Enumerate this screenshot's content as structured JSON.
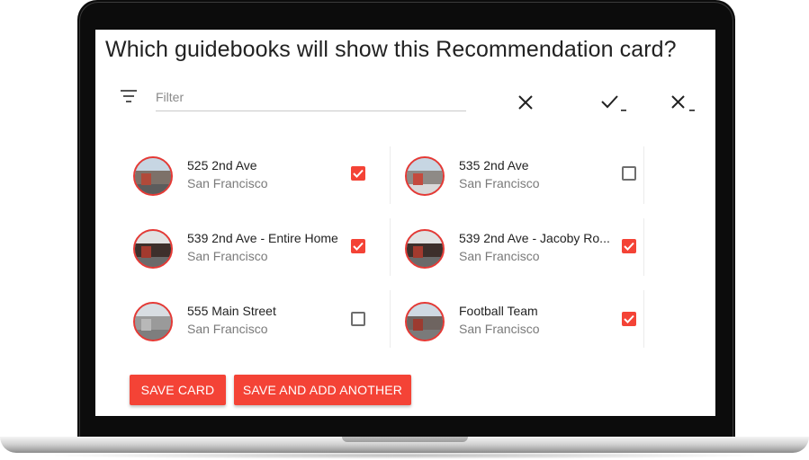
{
  "dialog": {
    "title": "Which guidebooks will show this Recommendation card?"
  },
  "filter": {
    "placeholder": "Filter",
    "value": ""
  },
  "toolbar": {
    "clear_icon": "close-icon",
    "select_all_icon": "check-all-icon",
    "deselect_all_icon": "close-all-icon"
  },
  "guidebooks": [
    {
      "name": "525 2nd Ave",
      "city": "San Francisco",
      "checked": true
    },
    {
      "name": "535 2nd Ave",
      "city": "San Francisco",
      "checked": false
    },
    {
      "name": "539 2nd Ave - Entire Home",
      "city": "San Francisco",
      "checked": true
    },
    {
      "name": "539 2nd Ave - Jacoby Ro...",
      "city": "San Francisco",
      "checked": true
    },
    {
      "name": "555 Main Street",
      "city": "San Francisco",
      "checked": false
    },
    {
      "name": "Football Team",
      "city": "San Francisco",
      "checked": true
    }
  ],
  "actions": {
    "save_label": "SAVE CARD",
    "save_add_label": "SAVE AND ADD ANOTHER"
  },
  "colors": {
    "accent": "#f44336",
    "laptop_bezel": "#0c0c0c"
  }
}
